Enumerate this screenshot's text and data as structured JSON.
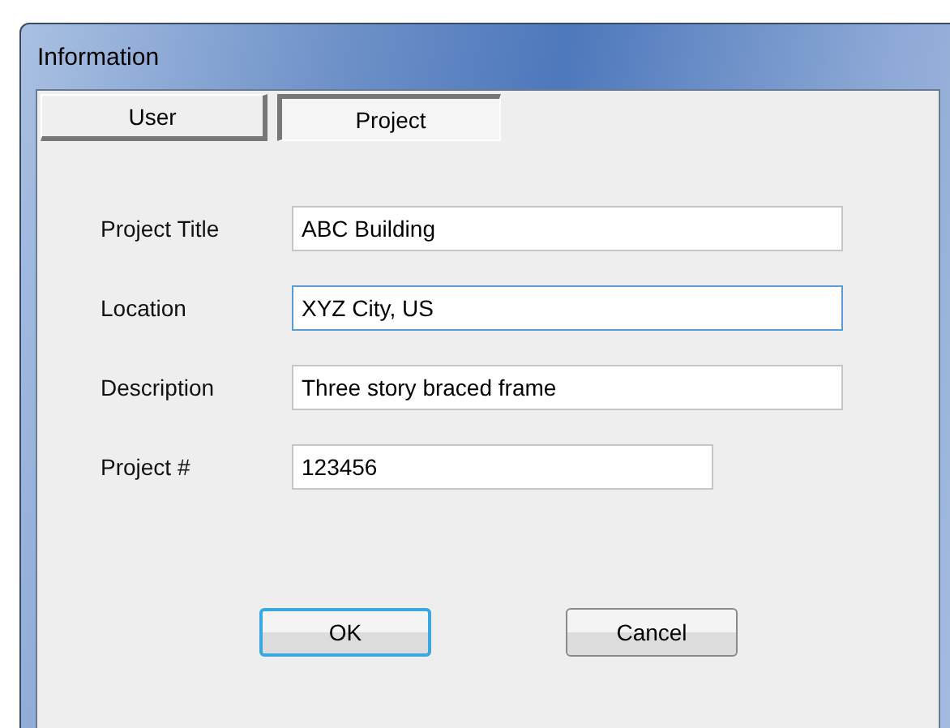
{
  "window": {
    "title": "Information"
  },
  "tabs": [
    {
      "label": "User",
      "selected": false
    },
    {
      "label": "Project",
      "selected": true
    }
  ],
  "fields": [
    {
      "label": "Project Title",
      "value": "ABC Building",
      "focused": false,
      "wide": true
    },
    {
      "label": "Location",
      "value": "XYZ City, US",
      "focused": true,
      "wide": true
    },
    {
      "label": "Description",
      "value": "Three story braced frame",
      "focused": false,
      "wide": true
    },
    {
      "label": "Project #",
      "value": "123456",
      "focused": false,
      "wide": false
    }
  ],
  "buttons": [
    {
      "label": "OK",
      "default": true
    },
    {
      "label": "Cancel",
      "default": false
    }
  ]
}
